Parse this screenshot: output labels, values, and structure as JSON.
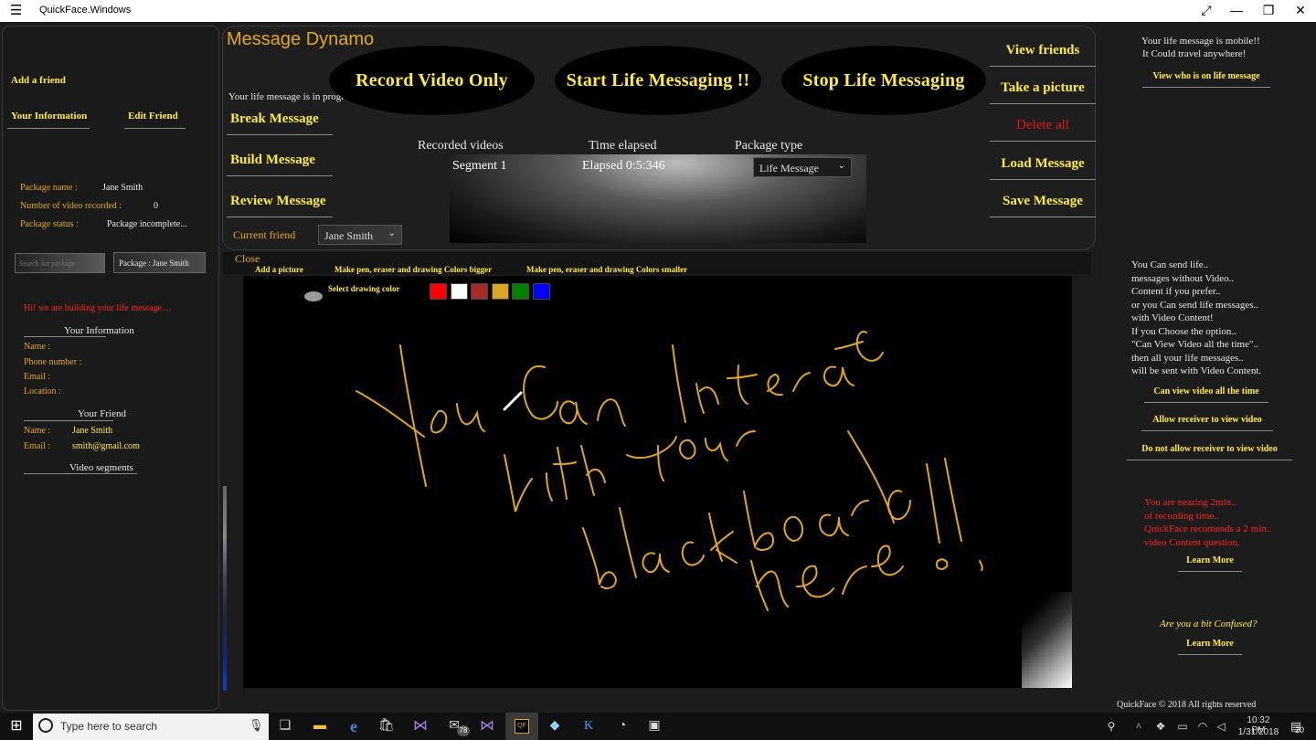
{
  "window": {
    "title": "QuickFace.Windows",
    "menu_glyph": "☰",
    "wc_restore": "⤢",
    "wc_min": "—",
    "wc_max": "❐",
    "wc_close": "✕"
  },
  "left": {
    "add_friend": "Add a friend",
    "your_information_btn": "Your Information",
    "edit_friend_btn": "Edit Friend",
    "package_name_label": "Package name :",
    "package_name_value": "Jane Smith",
    "videos_recorded_label": "Number of video recorded :",
    "videos_recorded_value": "0",
    "package_status_label": "Package status :",
    "package_status_value": "Package incomplete...",
    "search_placeholder": "Search for package",
    "package_dropdown": "Package : Jane Smith",
    "building_msg": "Hi! we are building your life message....",
    "your_info_heading": "Your Information",
    "name_label": "Name :",
    "phone_label": "Phone number :",
    "email_label": "Email :",
    "location_label": "Location :",
    "your_friend_heading": "Your Friend",
    "friend_name_label": "Name :",
    "friend_name_value": "Jane Smith",
    "friend_email_label": "Email :",
    "friend_email_value": "smith@gmail.com",
    "video_segments": "Video segments"
  },
  "top": {
    "app_title": "Message Dynamo",
    "progress": "Your life message is in progress...",
    "record_video_only": "Record Video Only",
    "start_life": "Start Life Messaging !!",
    "stop_life": "Stop Life Messaging",
    "break_message": "Break Message",
    "build_message": "Build Message",
    "review_message": "Review Message",
    "current_friend_label": "Current friend",
    "current_friend_value": "Jane Smith",
    "col_recorded": "Recorded videos",
    "col_elapsed": "Time elapsed",
    "col_package": "Package type",
    "row_segment": "Segment 1",
    "row_elapsed": "Elapsed 0:5:346",
    "row_package": "Life Message",
    "view_friends": "View friends",
    "take_picture": "Take a picture",
    "delete_all": "Delete all",
    "load_message": "Load Message",
    "save_message": "Save Message"
  },
  "board": {
    "close": "Close",
    "add_picture": "Add a picture",
    "pen_bigger": "Make pen, eraser and drawing Colors bigger",
    "pen_smaller": "Make pen, eraser and drawing Colors smaller",
    "select_color": "Select drawing color",
    "swatches": [
      "#ff0000",
      "#ffffff",
      "#a52a2a",
      "#daa520",
      "#008000",
      "#0000ff"
    ],
    "ink_color": "#e3a71b"
  },
  "right": {
    "mobile_1": "Your life message is mobile!!",
    "mobile_2": "It Could travel anywhere!",
    "view_who": "View who is on life message",
    "info_lines": [
      "You Can send life..",
      "messages without Video..",
      "Content if you prefer..",
      "or you Can send life messages..",
      "with Video Content!",
      "If you Choose the option..",
      "\"Can View Video all the time\"..",
      "then all your life messages..",
      "will be sent with Video Content."
    ],
    "can_view": "Can view video all the time",
    "allow_receiver": "Allow receiver to view video",
    "do_not_allow": "Do not allow receiver to view video",
    "warn_lines": [
      "You are nearing 2min..",
      "of recording time..",
      "QuickFace recomends a 2 min..",
      "video Content question."
    ],
    "learn_more_1": "Learn More",
    "confused": "Are you a bit Confused?",
    "learn_more_2": "Learn More",
    "copyright": "QuickFace © 2018 All rights reserved"
  },
  "taskbar": {
    "search_placeholder": "Type here to search",
    "mail_badge": "78",
    "time": "10:32 PM",
    "date": "1/31/2018",
    "notif_count": "20"
  }
}
